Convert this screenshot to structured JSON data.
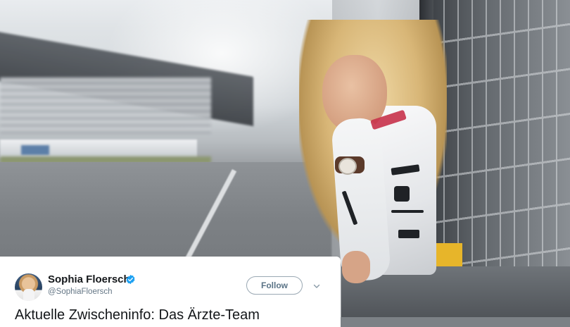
{
  "tweet": {
    "author": {
      "display_name": "Sophia Floersch",
      "handle": "@SophiaFloersch",
      "verified_icon": "verified-badge-icon",
      "verified_color": "#1DA1F2"
    },
    "follow_label": "Follow",
    "menu_icon": "chevron-down-icon",
    "text": "Aktuelle Zwischeninfo: Das Ärzte-Team"
  },
  "photo": {
    "subject": "racing-driver-photo"
  },
  "colors": {
    "card_background": "#FFFFFF",
    "name_text": "#14171A",
    "handle_text": "#657786",
    "follow_border": "#9AA8B3"
  }
}
